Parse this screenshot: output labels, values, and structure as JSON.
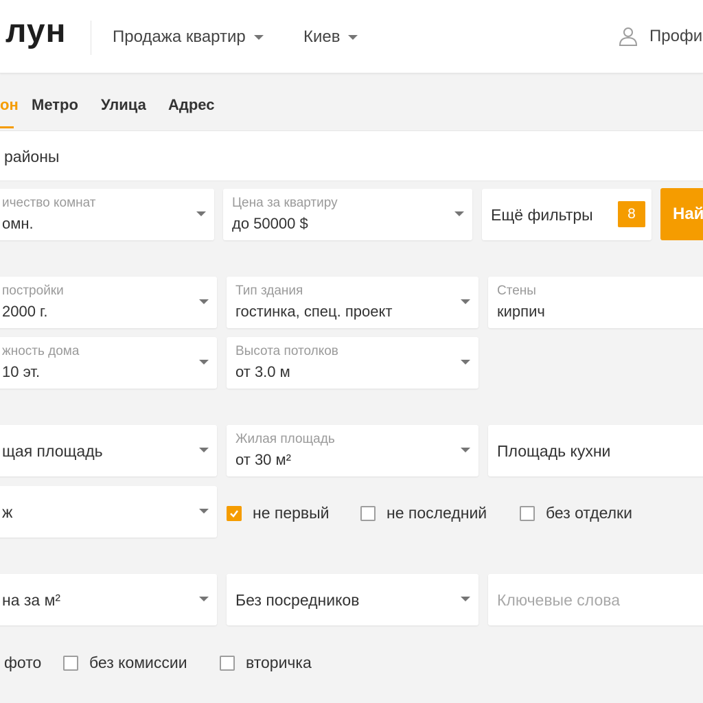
{
  "header": {
    "logo": "лун",
    "deal_type": "Продажа квартир",
    "city": "Киев",
    "profile": "Профи"
  },
  "tabs": [
    {
      "label": "он",
      "active": true
    },
    {
      "label": "Метро",
      "active": false
    },
    {
      "label": "Улица",
      "active": false
    },
    {
      "label": "Адрес",
      "active": false
    }
  ],
  "district": {
    "text": "районы"
  },
  "filters_row1": {
    "rooms": {
      "label": "ичество комнат",
      "value": "омн."
    },
    "price": {
      "label": "Цена за квартиру",
      "value": "до 50000 $"
    },
    "more_filters": {
      "label": "Ещё фильтры",
      "count": "8"
    },
    "find_button": "Най"
  },
  "building": {
    "year": {
      "label": "постройки",
      "value": "2000 г."
    },
    "type": {
      "label": "Тип здания",
      "value": "гостинка, спец. проект"
    },
    "walls": {
      "label": "Стены",
      "value": "кирпич"
    },
    "floors": {
      "label": "жность дома",
      "value": "10 эт."
    },
    "ceiling": {
      "label": "Высота потолков",
      "value": "от 3.0 м"
    }
  },
  "area": {
    "total": {
      "value": "щая площадь"
    },
    "living": {
      "label": "Жилая площадь",
      "value": "от 30 м²"
    },
    "kitchen": {
      "value": "Площадь кухни"
    }
  },
  "floor": {
    "select": {
      "value": "ж"
    },
    "checkboxes": [
      {
        "label": "не первый",
        "checked": true
      },
      {
        "label": "не последний",
        "checked": false
      },
      {
        "label": "без отделки",
        "checked": false
      }
    ]
  },
  "misc": {
    "price_m2": {
      "value": "на за м²"
    },
    "agents": {
      "value": "Без посредников"
    },
    "keywords": {
      "placeholder": "Ключевые слова"
    },
    "checkboxes": [
      {
        "label": "фото",
        "checked": false
      },
      {
        "label": "без комиссии",
        "checked": false
      },
      {
        "label": "вторичка",
        "checked": false
      }
    ]
  },
  "colors": {
    "accent": "#f59c00",
    "background": "#f3f3f3"
  }
}
